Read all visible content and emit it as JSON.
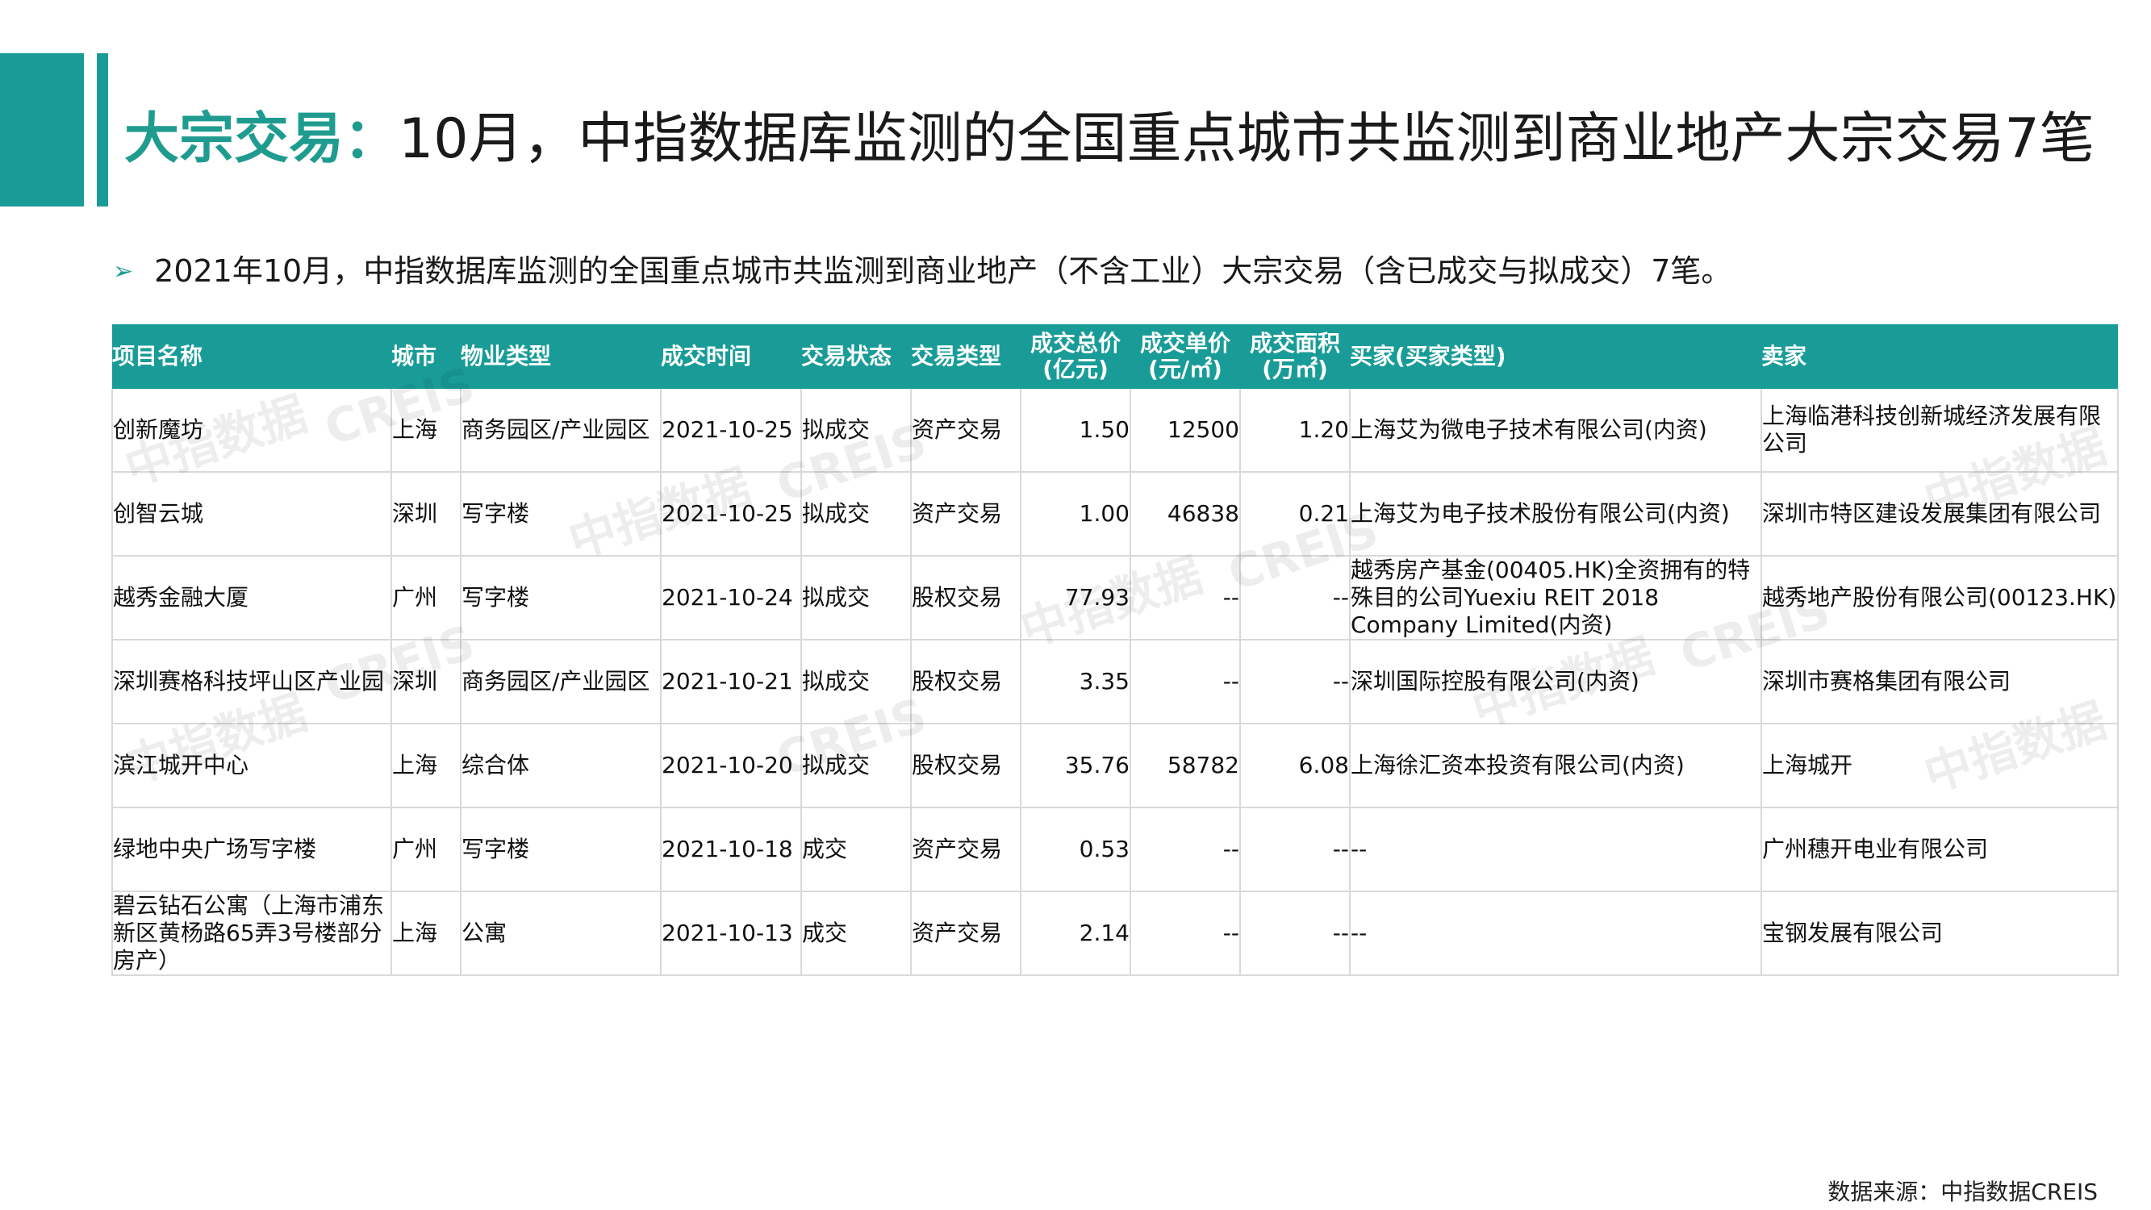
{
  "title": {
    "accent": "大宗交易",
    "colon": "：",
    "text": "10月，中指数据库监测的全国重点城市共监测到商业地产大宗交易7笔"
  },
  "bullet": {
    "text": "2021年10月，中指数据库监测的全国重点城市共监测到商业地产（不含工业）大宗交易（含已成交与拟成交）7笔。"
  },
  "table": {
    "headers": [
      {
        "line1": "项目名称",
        "line2": ""
      },
      {
        "line1": "城市",
        "line2": ""
      },
      {
        "line1": "物业类型",
        "line2": ""
      },
      {
        "line1": "成交时间",
        "line2": ""
      },
      {
        "line1": "交易状态",
        "line2": ""
      },
      {
        "line1": "交易类型",
        "line2": ""
      },
      {
        "line1": "成交总价",
        "line2": "(亿元)"
      },
      {
        "line1": "成交单价",
        "line2": "(元/㎡)"
      },
      {
        "line1": "成交面积",
        "line2": "(万㎡)"
      },
      {
        "line1": "买家(买家类型)",
        "line2": ""
      },
      {
        "line1": "卖家",
        "line2": ""
      }
    ],
    "rows": [
      [
        "创新魔坊",
        "上海",
        "商务园区/产业园区",
        "2021-10-25",
        "拟成交",
        "资产交易",
        "1.50",
        "12500",
        "1.20",
        "上海艾为微电子技术有限公司(内资)",
        "上海临港科技创新城经济发展有限公司"
      ],
      [
        "创智云城",
        "深圳",
        "写字楼",
        "2021-10-25",
        "拟成交",
        "资产交易",
        "1.00",
        "46838",
        "0.21",
        "上海艾为电子技术股份有限公司(内资)",
        "深圳市特区建设发展集团有限公司"
      ],
      [
        "越秀金融大厦",
        "广州",
        "写字楼",
        "2021-10-24",
        "拟成交",
        "股权交易",
        "77.93",
        "--",
        "--",
        "越秀房产基金(00405.HK)全资拥有的特殊目的公司Yuexiu REIT 2018 Company Limited(内资)",
        "越秀地产股份有限公司(00123.HK)"
      ],
      [
        "深圳赛格科技坪山区产业园",
        "深圳",
        "商务园区/产业园区",
        "2021-10-21",
        "拟成交",
        "股权交易",
        "3.35",
        "--",
        "--",
        "深圳国际控股有限公司(内资)",
        "深圳市赛格集团有限公司"
      ],
      [
        "滨江城开中心",
        "上海",
        "综合体",
        "2021-10-20",
        "拟成交",
        "股权交易",
        "35.76",
        "58782",
        "6.08",
        "上海徐汇资本投资有限公司(内资)",
        "上海城开"
      ],
      [
        "绿地中央广场写字楼",
        "广州",
        "写字楼",
        "2021-10-18",
        "成交",
        "资产交易",
        "0.53",
        "--",
        "--",
        "--",
        "广州穗开电业有限公司"
      ],
      [
        "碧云钻石公寓（上海市浦东新区黄杨路65弄3号楼部分房产）",
        "上海",
        "公寓",
        "2021-10-13",
        "成交",
        "资产交易",
        "2.14",
        "--",
        "--",
        "--",
        "宝钢发展有限公司"
      ]
    ]
  },
  "watermark": {
    "cn": "中指数据",
    "en": "CREIS"
  },
  "source": "数据来源：中指数据CREIS",
  "colors": {
    "accent": "#199c98",
    "title_accent": "#1f9c8f"
  }
}
